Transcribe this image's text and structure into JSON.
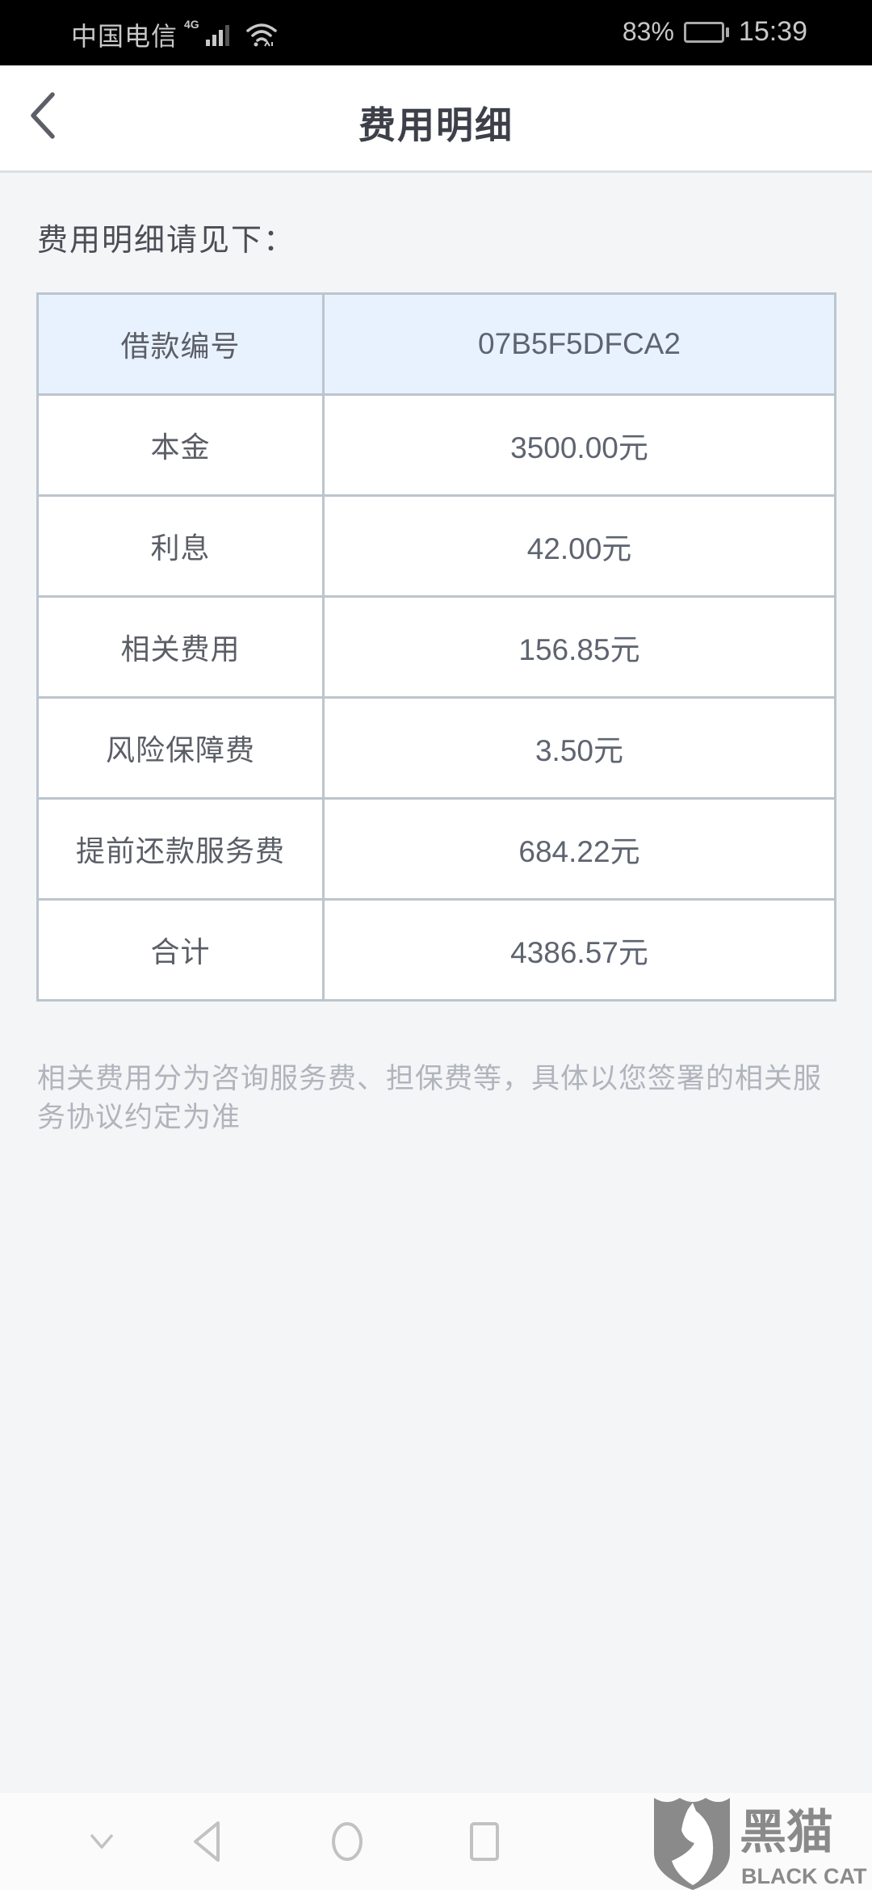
{
  "status_bar": {
    "carrier": "中国电信",
    "network_type": "4G",
    "signal_icon": "signal-icon",
    "wifi_icon": "wifi-icon",
    "battery_percent": "83%",
    "battery_level": 0.83,
    "time": "15:39"
  },
  "header": {
    "back_icon": "chevron-left-icon",
    "title": "费用明细"
  },
  "content": {
    "intro": "费用明细请见下：",
    "table": {
      "rows": [
        {
          "label": "借款编号",
          "value": "07B5F5DFCA2"
        },
        {
          "label": "本金",
          "value": "3500.00元"
        },
        {
          "label": "利息",
          "value": "42.00元"
        },
        {
          "label": "相关费用",
          "value": "156.85元"
        },
        {
          "label": "风险保障费",
          "value": "3.50元"
        },
        {
          "label": "提前还款服务费",
          "value": "684.22元"
        },
        {
          "label": "合计",
          "value": "4386.57元"
        }
      ]
    },
    "footnote": "相关费用分为咨询服务费、担保费等，具体以您签署的相关服务协议约定为准"
  },
  "nav_bar": {
    "buttons": [
      "chevron-down-icon",
      "back-triangle-icon",
      "home-circle-icon",
      "recents-square-icon"
    ]
  },
  "watermark": {
    "name_cn": "黑猫",
    "name_en": "BLACK CAT"
  },
  "colors": {
    "table_header_bg": "#e8f2fe",
    "table_border": "#bcc5ce",
    "page_bg": "#f4f5f7",
    "title": "#3d4049",
    "footnote": "#b0b4bc"
  }
}
